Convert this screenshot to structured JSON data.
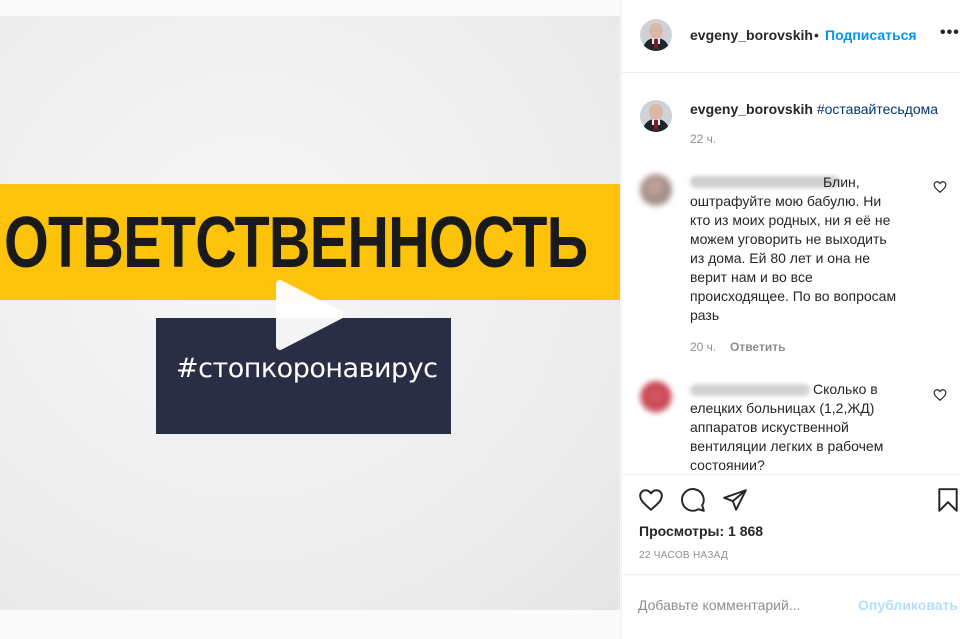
{
  "media": {
    "big_word": "ОТВЕТСТВЕННОСТЬ",
    "hashtag": "#стопкоронавирус",
    "play_icon": "play-icon",
    "colors": {
      "band": "#fdc20a",
      "box": "#2a2e45"
    }
  },
  "header": {
    "username": "evgeny_borovskih",
    "separator": "•",
    "follow_label": "Подписаться",
    "more_label": "•••"
  },
  "caption": {
    "username": "evgeny_borovskih",
    "hashtag": "#оставайтесьдома",
    "time": "22 ч."
  },
  "comments": [
    {
      "text_lines": [
        "Блин,",
        "оштрафуйте мою бабулю. Ни",
        "кто из моих родных, ни я её не",
        "можем уговорить не выходить",
        "из дома. Ей 80 лет и она не",
        "верит нам и во все",
        "происходящее. По во вопросам",
        "разь"
      ],
      "time": "20 ч.",
      "reply_label": "Ответить"
    },
    {
      "text_lines": [
        "Сколько в",
        "елецких больницах (1,2,ЖД)",
        "аппаратов искуственной",
        "вентиляции легких в рабочем",
        "состоянии?"
      ]
    }
  ],
  "actions": {
    "views": "Просмотры: 1 868",
    "posted": "22 ЧАСОВ НАЗАД"
  },
  "add_comment": {
    "placeholder": "Добавьте комментарий...",
    "publish_label": "Опубликовать"
  },
  "colors": {
    "accent": "#0095f6",
    "publish_disabled": "#b2dffc",
    "muted": "#8e8e8e"
  }
}
